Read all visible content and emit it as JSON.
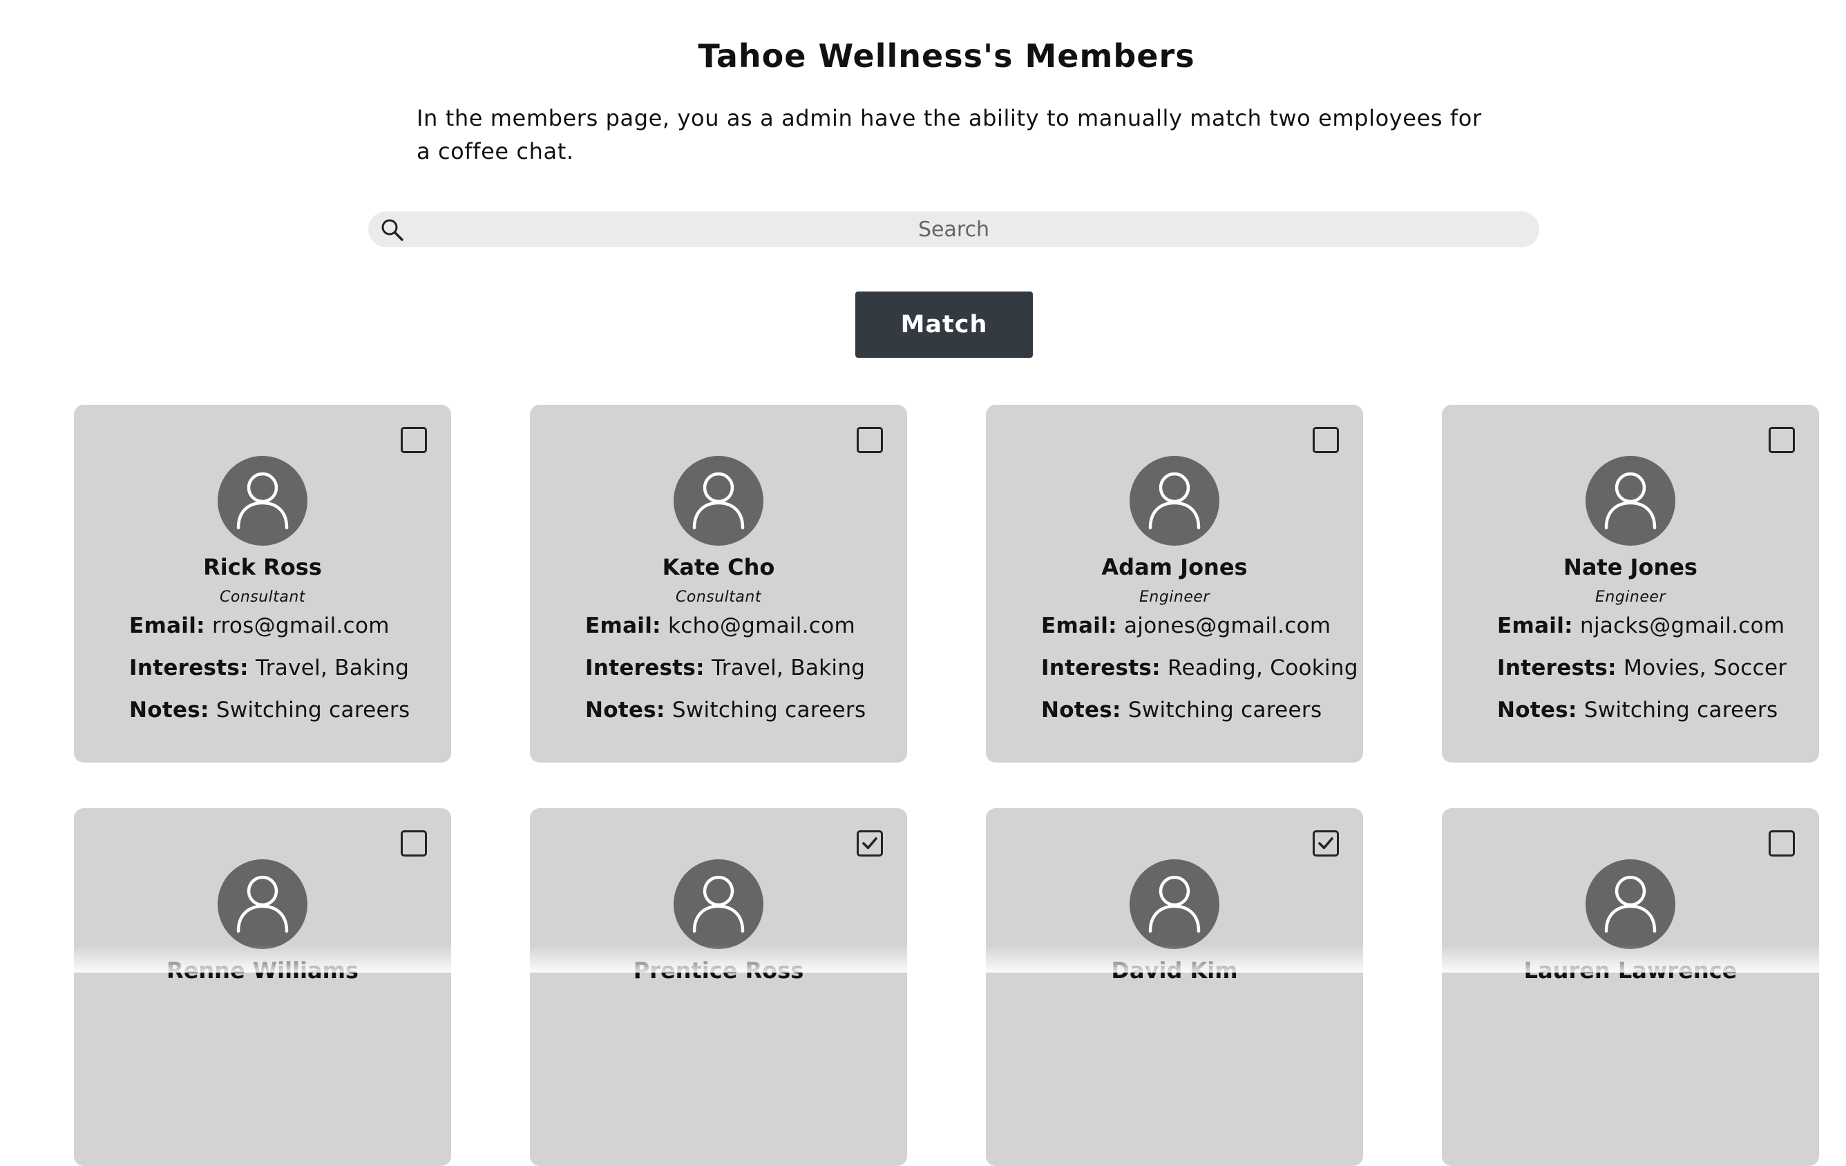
{
  "header": {
    "title": "Tahoe Wellness's Members",
    "description": "In the members page, you as a admin have the ability to manually match two employees for a coffee chat."
  },
  "search": {
    "placeholder": "Search",
    "value": "",
    "icon": "search-icon"
  },
  "match_button": {
    "label": "Match"
  },
  "field_labels": {
    "email": "Email:",
    "interests": "Interests:",
    "notes": "Notes:"
  },
  "members": [
    {
      "name": "Rick Ross",
      "role": "Consultant",
      "email": "rros@gmail.com",
      "interests": "Travel, Baking",
      "notes": "Switching careers",
      "checked": false
    },
    {
      "name": "Kate Cho",
      "role": "Consultant",
      "email": "kcho@gmail.com",
      "interests": "Travel, Baking",
      "notes": "Switching careers",
      "checked": false
    },
    {
      "name": "Adam Jones",
      "role": "Engineer",
      "email": "ajones@gmail.com",
      "interests": "Reading, Cooking",
      "notes": "Switching careers",
      "checked": false
    },
    {
      "name": "Nate Jones",
      "role": "Engineer",
      "email": "njacks@gmail.com",
      "interests": "Movies, Soccer",
      "notes": "Switching careers",
      "checked": false
    },
    {
      "name": "Renne Williams",
      "checked": false
    },
    {
      "name": "Prentice Ross",
      "checked": true
    },
    {
      "name": "David Kim",
      "checked": true
    },
    {
      "name": "Lauren Lawrence",
      "checked": false
    }
  ],
  "colors": {
    "card_background": "#d3d3d3",
    "avatar_background": "#666666",
    "button_background": "#343a42",
    "search_background": "#ebebea"
  }
}
